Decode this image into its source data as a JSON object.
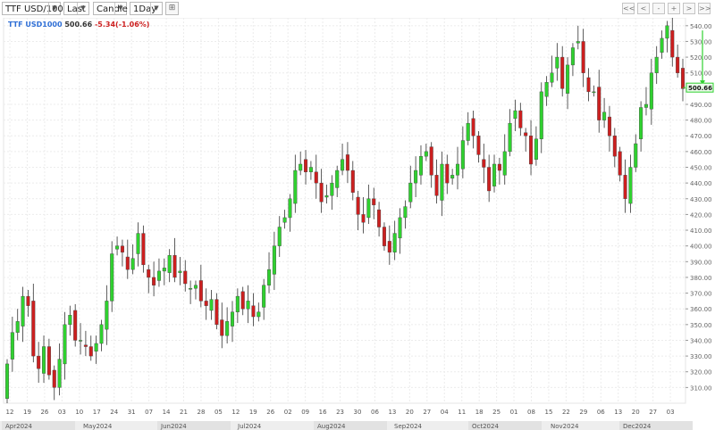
{
  "toolbar": {
    "symbol": "TTF USD/100",
    "price_type": "Last",
    "chart_style": "Candle",
    "interval": "1Day",
    "nav_buttons": [
      "<<",
      "<",
      "-",
      "+",
      ">",
      ">>"
    ]
  },
  "legend": {
    "symbol": "TTF USD1000",
    "last": "500.66",
    "change": "-5.34(-1.06%)"
  },
  "colors": {
    "up": "#2fd12f",
    "down": "#cc1f1f",
    "symbol": "#2f6fd6",
    "price_tag": "#2fd12f"
  },
  "chart_data": {
    "type": "candlestick",
    "y_axis": {
      "min": 300,
      "max": 545,
      "ticks": [
        310,
        320,
        330,
        340,
        350,
        360,
        370,
        380,
        390,
        400,
        410,
        420,
        430,
        440,
        450,
        460,
        470,
        480,
        490,
        500,
        510,
        520,
        530,
        540
      ],
      "position": "right"
    },
    "last_price_label": "500.66",
    "x_day_labels": [
      "12",
      "19",
      "26",
      "03",
      "10",
      "17",
      "24",
      "31",
      "07",
      "14",
      "21",
      "28",
      "05",
      "12",
      "19",
      "26",
      "02",
      "09",
      "16",
      "23",
      "30",
      "06",
      "13",
      "20",
      "27",
      "04",
      "11",
      "18",
      "25",
      "01",
      "08",
      "15",
      "22",
      "29",
      "06",
      "13",
      "20",
      "27",
      "03"
    ],
    "x_month_labels": [
      "Apr2024",
      "May2024",
      "Jun2024",
      "Jul2024",
      "Aug2024",
      "Sep2024",
      "Oct2024",
      "Nov2024",
      "Dec2024"
    ],
    "grid": true,
    "close_series": [
      325,
      345,
      352,
      368,
      362,
      330,
      322,
      336,
      318,
      310,
      328,
      350,
      356,
      340,
      340,
      336,
      330,
      338,
      350,
      365,
      395,
      400,
      396,
      385,
      392,
      408,
      388,
      380,
      375,
      384,
      386,
      394,
      380,
      384,
      376,
      373,
      375,
      365,
      362,
      366,
      350,
      343,
      352,
      358,
      368,
      360,
      365,
      355,
      358,
      375,
      385,
      400,
      412,
      418,
      430,
      448,
      452,
      447,
      450,
      440,
      428,
      432,
      440,
      448,
      455,
      448,
      434,
      420,
      415,
      430,
      426,
      412,
      400,
      396,
      408,
      418,
      425,
      440,
      448,
      457,
      460,
      445,
      432,
      452,
      440,
      445,
      452,
      467,
      478,
      470,
      458,
      450,
      435,
      452,
      448,
      460,
      478,
      486,
      475,
      470,
      452,
      468,
      498,
      504,
      510,
      520,
      500,
      515,
      526,
      530,
      510,
      498,
      498,
      480,
      485,
      470,
      457,
      445,
      430,
      450,
      465,
      488,
      490,
      510,
      520,
      532,
      540,
      520,
      510,
      500
    ]
  }
}
